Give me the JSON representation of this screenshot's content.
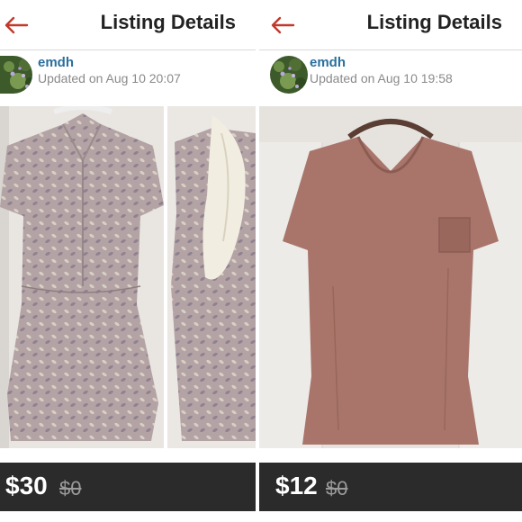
{
  "listings": [
    {
      "header_title": "Listing Details",
      "username": "emdh",
      "updated": "Updated on Aug 10 20:07",
      "price": "$30",
      "original_price": "$0"
    },
    {
      "header_title": "Listing Details",
      "username": "emdh",
      "updated": "Updated on Aug 10 19:58",
      "price": "$12",
      "original_price": "$0"
    }
  ],
  "icons": {
    "back": "back-arrow-icon"
  },
  "colors": {
    "accent": "#c0392b",
    "username": "#2a6f9e",
    "price_bar": "#2b2b2b"
  }
}
